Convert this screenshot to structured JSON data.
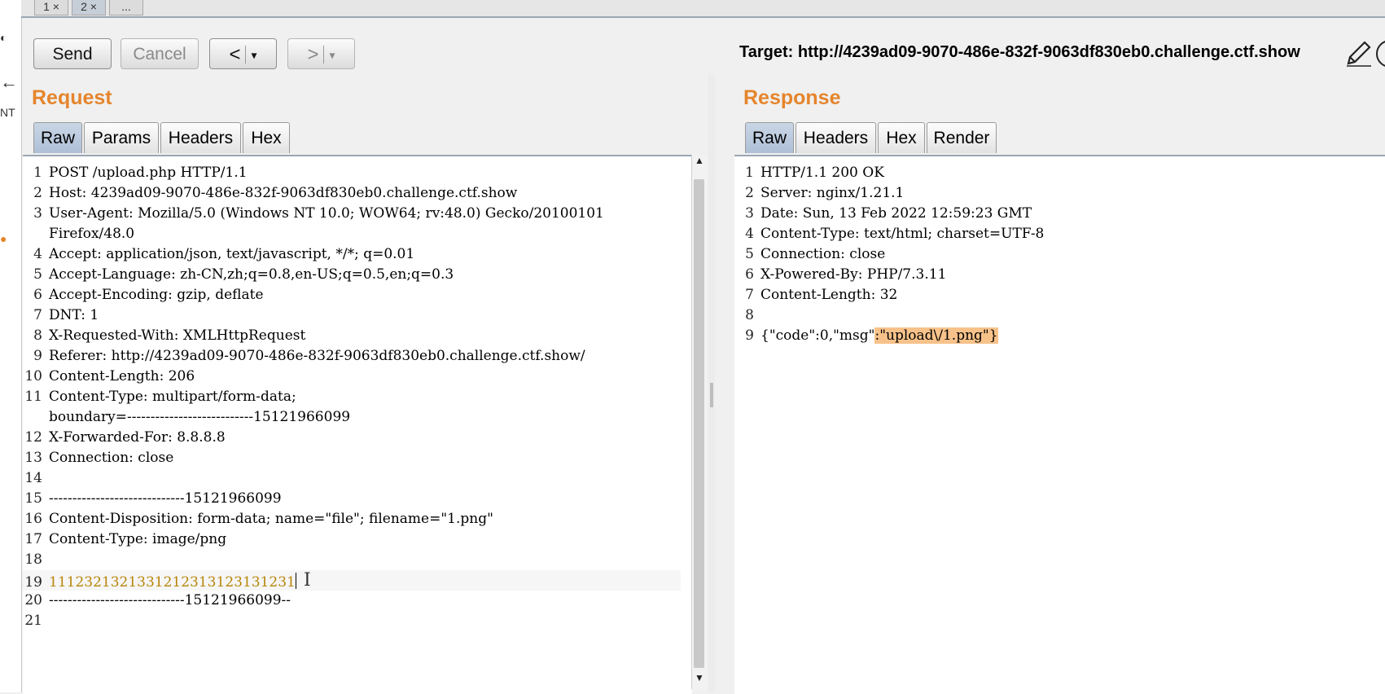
{
  "top_tabs": [
    {
      "label": "1",
      "close": "×"
    },
    {
      "label": "2",
      "close": "×"
    },
    {
      "label": "..."
    }
  ],
  "toolbar": {
    "send_label": "Send",
    "cancel_label": "Cancel",
    "back_label": "<",
    "forward_label": ">",
    "dropdown_glyph": "▾"
  },
  "target": {
    "text": "Target: http://4239ad09-9070-486e-832f-9063df830eb0.challenge.ctf.show"
  },
  "request": {
    "title": "Request",
    "tabs": [
      "Raw",
      "Params",
      "Headers",
      "Hex"
    ],
    "active_tab": "Raw",
    "lines": [
      {
        "n": "1",
        "text": "POST /upload.php HTTP/1.1"
      },
      {
        "n": "2",
        "text": "Host: 4239ad09-9070-486e-832f-9063df830eb0.challenge.ctf.show"
      },
      {
        "n": "3",
        "text": "User-Agent: Mozilla/5.0 (Windows NT 10.0; WOW64; rv:48.0) Gecko/20100101"
      },
      {
        "n": "",
        "text": "Firefox/48.0"
      },
      {
        "n": "4",
        "text": "Accept: application/json, text/javascript, */*; q=0.01"
      },
      {
        "n": "5",
        "text": "Accept-Language: zh-CN,zh;q=0.8,en-US;q=0.5,en;q=0.3"
      },
      {
        "n": "6",
        "text": "Accept-Encoding: gzip, deflate"
      },
      {
        "n": "7",
        "text": "DNT: 1"
      },
      {
        "n": "8",
        "text": "X-Requested-With: XMLHttpRequest"
      },
      {
        "n": "9",
        "text": "Referer: http://4239ad09-9070-486e-832f-9063df830eb0.challenge.ctf.show/"
      },
      {
        "n": "10",
        "text": "Content-Length: 206"
      },
      {
        "n": "11",
        "text": "Content-Type: multipart/form-data;"
      },
      {
        "n": "",
        "text": "boundary=---------------------------15121966099"
      },
      {
        "n": "12",
        "text": "X-Forwarded-For: 8.8.8.8"
      },
      {
        "n": "13",
        "text": "Connection: close"
      },
      {
        "n": "14",
        "text": ""
      },
      {
        "n": "15",
        "text": "-----------------------------15121966099"
      },
      {
        "n": "16",
        "text": "Content-Disposition: form-data; name=\"file\"; filename=\"1.png\""
      },
      {
        "n": "17",
        "text": "Content-Type: image/png"
      },
      {
        "n": "18",
        "text": ""
      },
      {
        "n": "19",
        "text": "1112321321331212313123131231"
      },
      {
        "n": "20",
        "text": "-----------------------------15121966099--"
      },
      {
        "n": "21",
        "text": ""
      }
    ]
  },
  "response": {
    "title": "Response",
    "tabs": [
      "Raw",
      "Headers",
      "Hex",
      "Render"
    ],
    "active_tab": "Raw",
    "lines": [
      {
        "n": "1",
        "text": "HTTP/1.1 200 OK"
      },
      {
        "n": "2",
        "text": "Server: nginx/1.21.1"
      },
      {
        "n": "3",
        "text": "Date: Sun, 13 Feb 2022 12:59:23 GMT"
      },
      {
        "n": "4",
        "text": "Content-Type: text/html; charset=UTF-8"
      },
      {
        "n": "5",
        "text": "Connection: close"
      },
      {
        "n": "6",
        "text": "X-Powered-By: PHP/7.3.11"
      },
      {
        "n": "7",
        "text": "Content-Length: 32"
      },
      {
        "n": "8",
        "text": ""
      },
      {
        "n": "9",
        "text_pre": "{\"code\":0,\"msg\"",
        "text_hl": ":\"upload\\/1.png\"}"
      }
    ]
  },
  "left_strip": [
    "NT"
  ],
  "colors": {
    "title": "#e5852c",
    "highlight": "#f7c28a",
    "active_tab": "#b9c8dc"
  }
}
